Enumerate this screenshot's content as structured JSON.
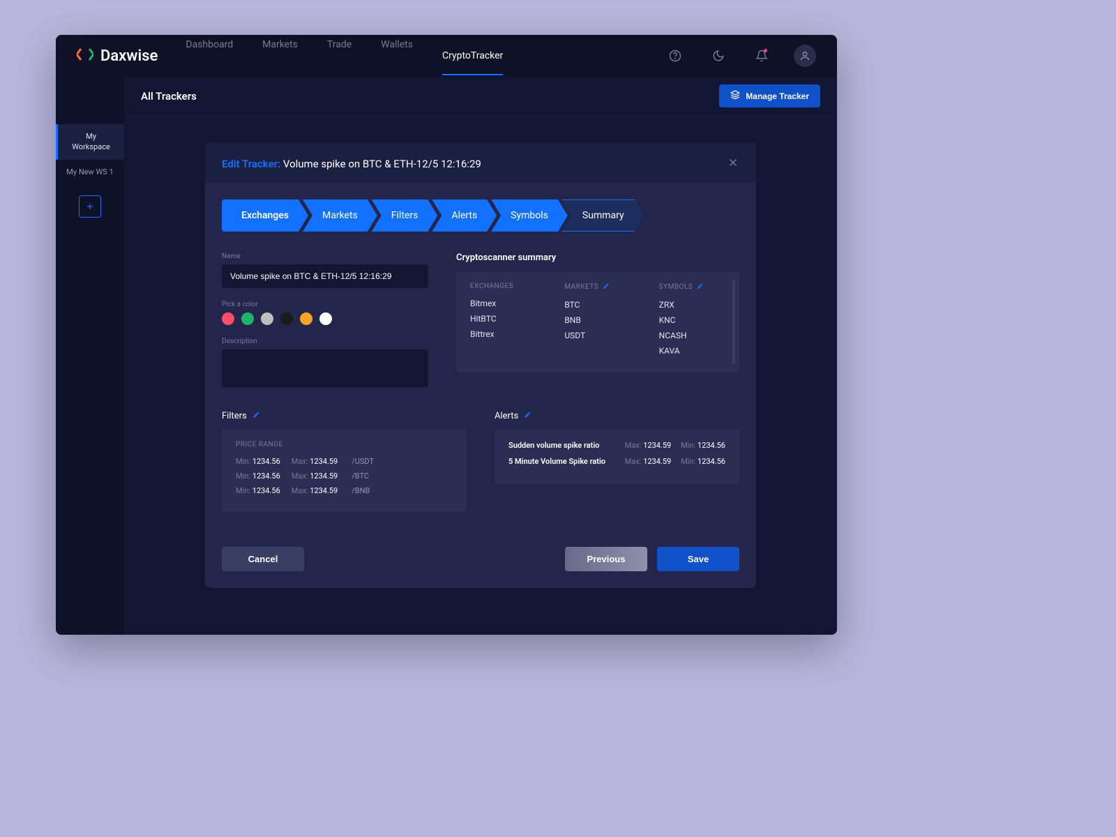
{
  "brand": "Daxwise",
  "nav": {
    "items": [
      "Dashboard",
      "Markets",
      "Trade",
      "Wallets",
      "CryptoTracker"
    ],
    "active": 4
  },
  "sidebar": {
    "ws": [
      "My Workspace",
      "My New WS 1"
    ],
    "active": 0
  },
  "subheader": {
    "title": "All Trackers",
    "manage_label": "Manage Tracker"
  },
  "modal": {
    "prefix": "Edit Tracker:",
    "name": "Volume spike on BTC & ETH-12/5 12:16:29",
    "steps": [
      "Exchanges",
      "Markets",
      "Filters",
      "Alerts",
      "Symbols",
      "Summary"
    ],
    "current_step": 5,
    "name_label": "Name",
    "name_value": "Volume spike on BTC & ETH-12/5 12:16:29",
    "color_label": "Pick a color",
    "colors": [
      "#ff4d6d",
      "#1fb36c",
      "#bfbfbf",
      "#1a1a1a",
      "#f5a623",
      "#ffffff"
    ],
    "desc_label": "Description",
    "summary_title": "Cryptoscanner summary",
    "summary": {
      "exchanges": {
        "head": "EXCHANGES",
        "items": [
          "Bitmex",
          "HitBTC",
          "Bittrex"
        ]
      },
      "markets": {
        "head": "MARKETS",
        "items": [
          "BTC",
          "BNB",
          "USDT"
        ]
      },
      "symbols": {
        "head": "SYMBOLS",
        "items": [
          "ZRX",
          "KNC",
          "NCASH",
          "KAVA"
        ]
      }
    },
    "filters": {
      "title": "Filters",
      "head": "PRICE RANGE",
      "rows": [
        {
          "min": "1234.56",
          "max": "1234.59",
          "unit": "/USDT"
        },
        {
          "min": "1234.56",
          "max": "1234.59",
          "unit": "/BTC"
        },
        {
          "min": "1234.56",
          "max": "1234.59",
          "unit": "/BNB"
        }
      ]
    },
    "alerts": {
      "title": "Alerts",
      "rows": [
        {
          "name": "Sudden volume spike ratio",
          "max": "1234.59",
          "min": "1234.56"
        },
        {
          "name": "5 Minute Volume Spike ratio",
          "max": "1234.59",
          "min": "1234.56"
        }
      ]
    },
    "buttons": {
      "cancel": "Cancel",
      "previous": "Previous",
      "save": "Save"
    },
    "labels": {
      "min": "Min:",
      "max": "Max:"
    }
  }
}
